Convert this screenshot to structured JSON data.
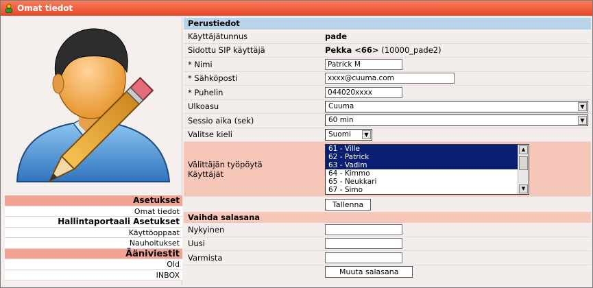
{
  "window": {
    "title": "Omat tiedot"
  },
  "menu": {
    "items": [
      {
        "label": "Asetukset",
        "kind": "section-pink"
      },
      {
        "label": "Omat tiedot",
        "kind": "link"
      },
      {
        "label": "Hallintaportaali Asetukset",
        "kind": "section-white"
      },
      {
        "label": "Käyttöoppaat",
        "kind": "link"
      },
      {
        "label": "Nauhoitukset",
        "kind": "link"
      },
      {
        "label": "Ääniviestit",
        "kind": "ani"
      },
      {
        "label": "Old",
        "kind": "link"
      },
      {
        "label": "INBOX",
        "kind": "link"
      }
    ]
  },
  "basic": {
    "header": "Perustiedot",
    "username_label": "Käyttäjätunnus",
    "username_value": "pade",
    "sip_label": "Sidottu SIP käyttäjä",
    "sip_value_bold": "Pekka <66>",
    "sip_value_extra": "(10000_pade2)",
    "name_label": "* Nimi",
    "name_value": "Patrick M",
    "email_label": "* Sähköposti",
    "email_value": "xxxx@cuuma.com",
    "phone_label": "* Puhelin",
    "phone_value": "044020xxxx",
    "theme_label": "Ulkoasu",
    "theme_value": "Cuuma",
    "session_label": "Sessio aika (sek)",
    "session_value": "60 min",
    "lang_label": "Valitse kieli",
    "lang_value": "Suomi",
    "desktop_label_1": "Välittäjän työpöytä",
    "desktop_label_2": "Käyttäjät",
    "desktop_users": [
      {
        "label": "61 - Ville",
        "selected": true
      },
      {
        "label": "62 - Patrick",
        "selected": true
      },
      {
        "label": "63 - Vadim",
        "selected": true
      },
      {
        "label": "64 - Kimmo",
        "selected": false
      },
      {
        "label": "65 - Neukkari",
        "selected": false
      },
      {
        "label": "67 - Simo",
        "selected": false
      }
    ],
    "save_label": "Tallenna"
  },
  "password": {
    "header": "Vaihda salasana",
    "current_label": "Nykyinen",
    "new_label": "Uusi",
    "confirm_label": "Varmista",
    "change_label": "Muuta salasana"
  },
  "colors": {
    "titlebar": "#e8462a",
    "section_pink": "#f2a394",
    "header_blue": "#b8d4ea",
    "row_pink": "#f6c7b9",
    "selection": "#0a1e72"
  },
  "icons": {
    "title": "user-icon",
    "avatar": "user-edit-icon"
  }
}
